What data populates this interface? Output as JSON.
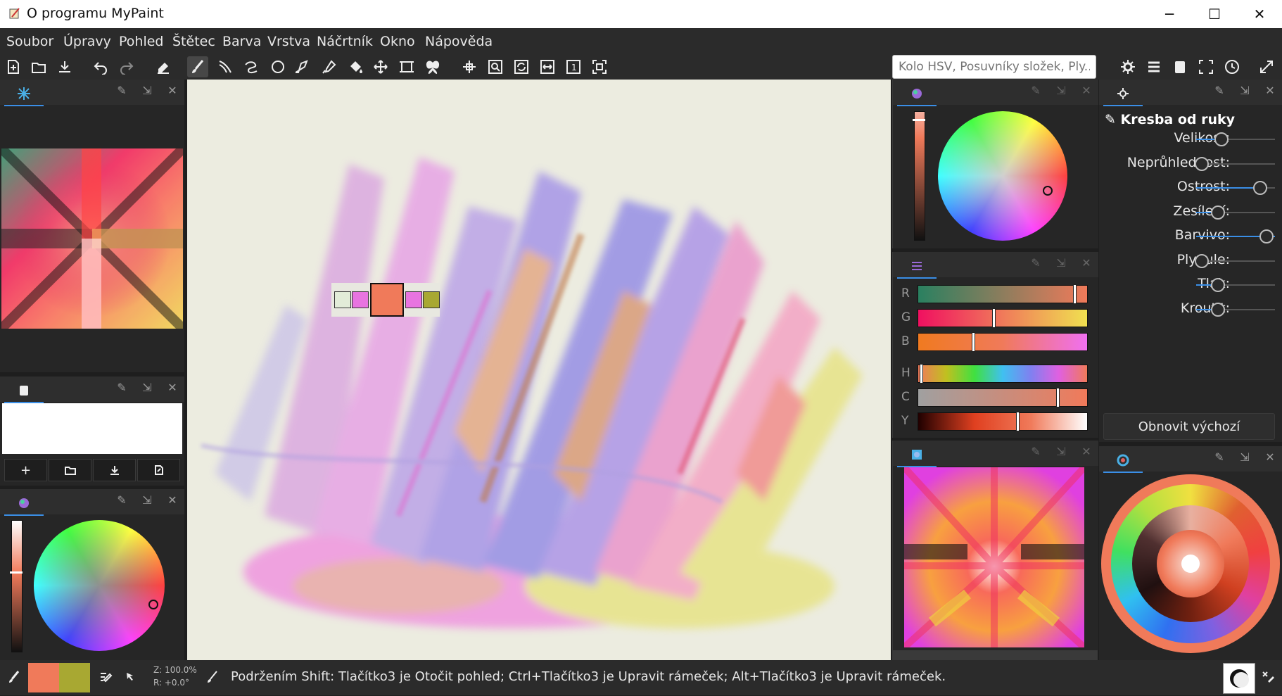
{
  "window": {
    "title": "O programu MyPaint",
    "minimize": "─",
    "maximize": "☐",
    "close": "✕"
  },
  "menu": [
    "Soubor",
    "Úpravy",
    "Pohled",
    "Štětec",
    "Barva",
    "Vrstva",
    "Náčrtník",
    "Okno",
    "Nápověda"
  ],
  "toolbar": {
    "icons": [
      "new-icon",
      "open-icon",
      "save-icon",
      "undo-icon",
      "redo-icon",
      "eraser-icon",
      "brush-icon",
      "inking-icon",
      "freehand-line-icon",
      "ellipse-icon",
      "pen-icon",
      "color-picker-icon",
      "fill-icon",
      "move-layer-icon",
      "frame-icon",
      "symmetry-icon",
      "pan-icon",
      "zoom-icon",
      "rotate-icon",
      "flip-icon",
      "reset-view-icon",
      "fit-view-icon"
    ],
    "search_placeholder": "Kolo HSV, Posuvníky složek, Ply...",
    "right_icons": [
      "settings-icon",
      "layers-icon",
      "scratchpad-icon",
      "fullscreen-icon",
      "clock-icon",
      "expand-icon"
    ]
  },
  "brush_settings": {
    "title": "Kresba od ruky",
    "sliders": [
      {
        "label": "Velikost:",
        "value": 0.3
      },
      {
        "label": "Neprůhlednost:",
        "value": 0.0
      },
      {
        "label": "Ostrost:",
        "value": 0.9
      },
      {
        "label": "Zesílení:",
        "value": 0.25
      },
      {
        "label": "Barvivo:",
        "value": 1.0
      },
      {
        "label": "Plynule:",
        "value": 0.0
      },
      {
        "label": "Tlak:",
        "value": 0.25
      },
      {
        "label": "Kroutit:",
        "value": 0.25
      }
    ],
    "reset_label": "Obnovit výchozí"
  },
  "component_sliders": [
    {
      "label": "R",
      "value": 0.93
    },
    {
      "label": "G",
      "value": 0.45
    },
    {
      "label": "B",
      "value": 0.33
    },
    {
      "label": "H",
      "value": 0.02
    },
    {
      "label": "C",
      "value": 0.83
    },
    {
      "label": "Y",
      "value": 0.59
    }
  ],
  "colors": {
    "current": "#f07a5a",
    "previous": "#a8a832",
    "accent": "#3a8ee6",
    "history": [
      "#e2ecd8",
      "#e874e0",
      "#f07a5a",
      "#e874e0",
      "#a8a832"
    ]
  },
  "status": {
    "zoom": "Z: 100.0%",
    "rotation": "R: +0.0°",
    "message": "Podržením Shift: Tlačítko3 je Otočit pohled;  Ctrl+Tlačítko3 je Upravit rámeček;  Alt+Tlačítko3 je Upravit rámeček."
  }
}
